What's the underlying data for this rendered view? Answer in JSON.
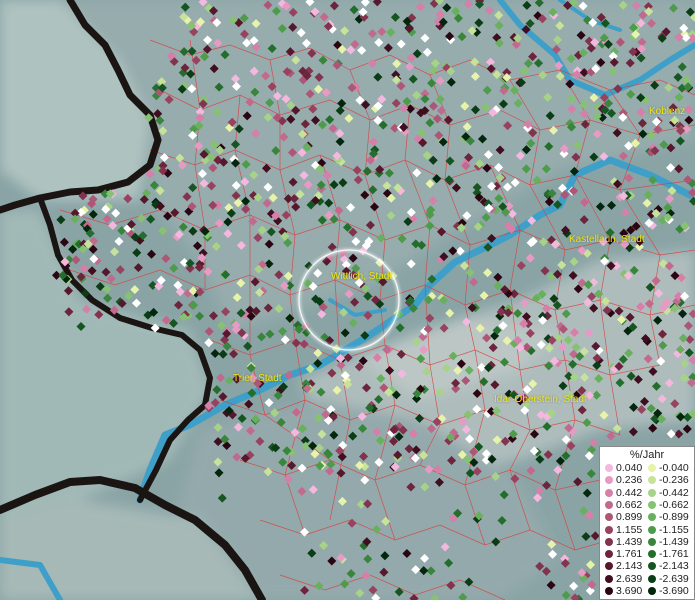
{
  "map": {
    "towns": [
      {
        "name": "Koblenz"
      },
      {
        "name": "Kastellaun, Stadt"
      },
      {
        "name": "Wittlich, Stadt"
      },
      {
        "name": "Trier, Stadt"
      },
      {
        "name": "Idar-Oberstein, Stadt"
      }
    ],
    "colors": {
      "water": "#3e9fc8",
      "borders": "#d94040",
      "country_border": "#1a1413",
      "label": "#f2e60a"
    }
  },
  "legend": {
    "title": "%/Jahr",
    "positive": [
      {
        "label": "0.040",
        "color": "#f4b8df"
      },
      {
        "label": "0.236",
        "color": "#e79ac4"
      },
      {
        "label": "0.442",
        "color": "#d67fa8"
      },
      {
        "label": "0.662",
        "color": "#c26a8e"
      },
      {
        "label": "0.899",
        "color": "#ad5676"
      },
      {
        "label": "1.155",
        "color": "#974360"
      },
      {
        "label": "1.439",
        "color": "#82334d"
      },
      {
        "label": "1.761",
        "color": "#6c253c"
      },
      {
        "label": "2.143",
        "color": "#56182d"
      },
      {
        "label": "2.639",
        "color": "#3f0e1f"
      },
      {
        "label": "3.690",
        "color": "#2a0612"
      }
    ],
    "negative": [
      {
        "label": "-0.040",
        "color": "#e6f3a8"
      },
      {
        "label": "-0.236",
        "color": "#c7e39a"
      },
      {
        "label": "-0.442",
        "color": "#a6d387"
      },
      {
        "label": "-0.662",
        "color": "#87c273"
      },
      {
        "label": "-0.899",
        "color": "#69b05e"
      },
      {
        "label": "-1.155",
        "color": "#4e9b4b"
      },
      {
        "label": "-1.439",
        "color": "#38853b"
      },
      {
        "label": "-1.761",
        "color": "#246d2d"
      },
      {
        "label": "-2.143",
        "color": "#155521"
      },
      {
        "label": "-2.639",
        "color": "#0a3c16"
      },
      {
        "label": "-3.690",
        "color": "#04260d"
      }
    ]
  }
}
